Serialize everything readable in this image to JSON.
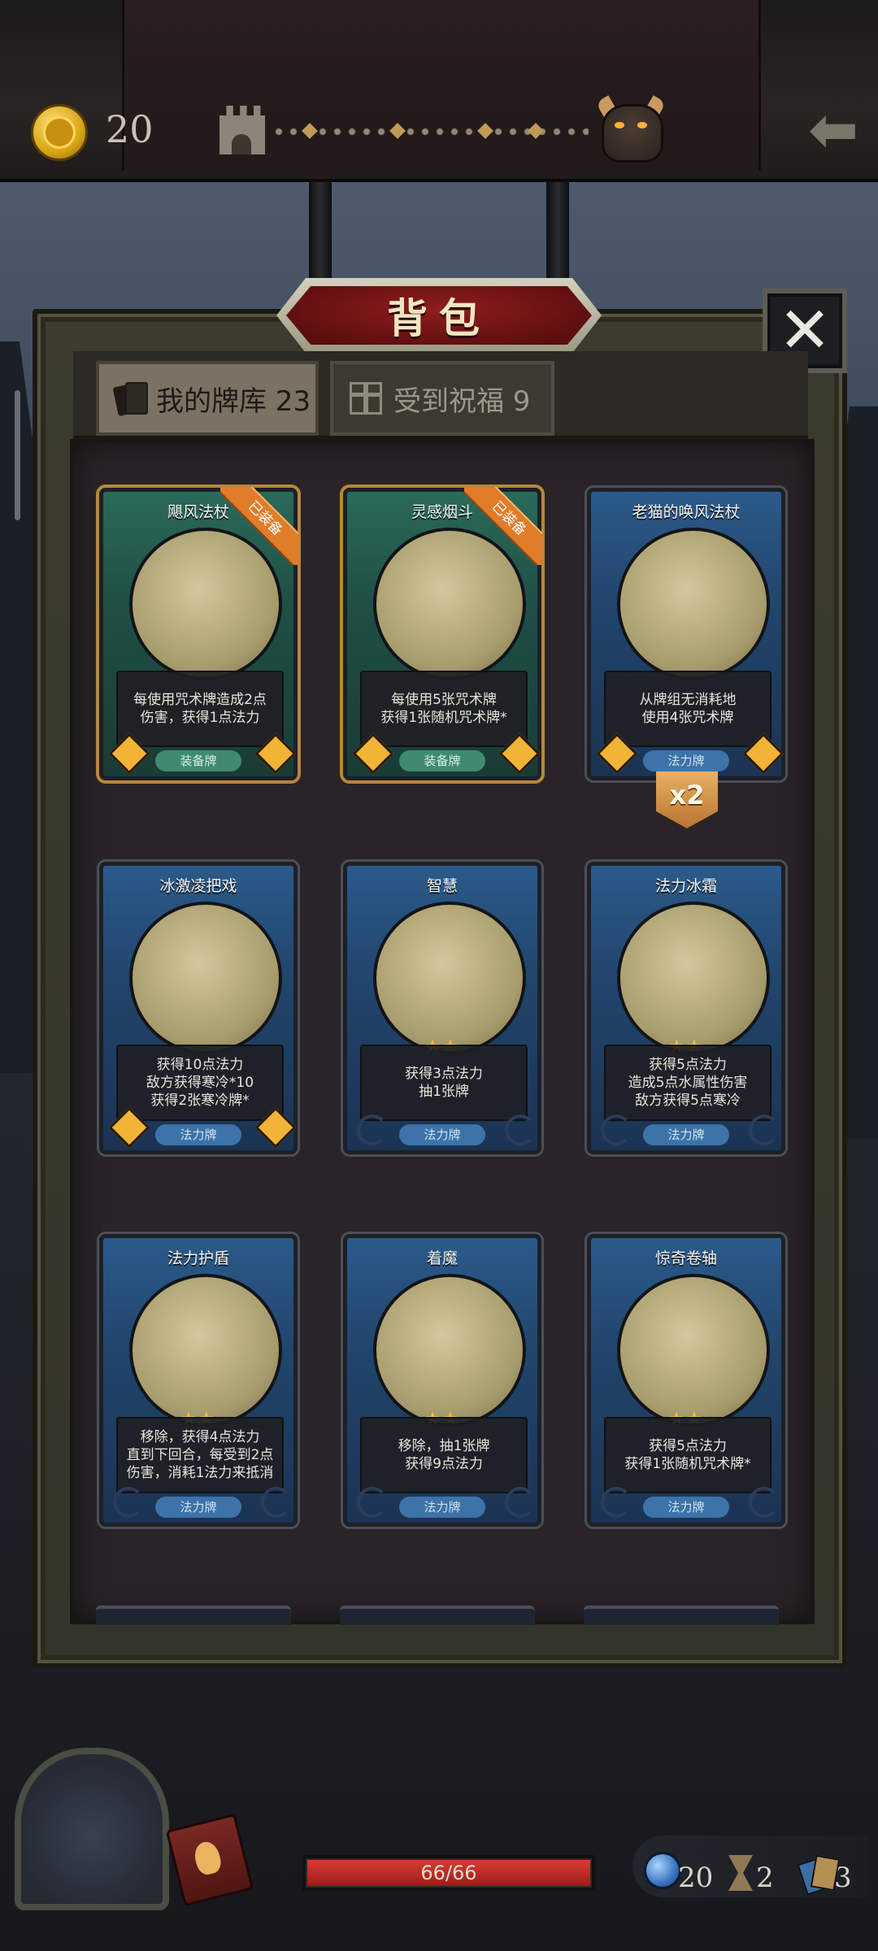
{
  "topbar": {
    "gold": "20",
    "icons": [
      "gold-coin-icon",
      "castle-icon",
      "boss-icon",
      "back-arrow-icon"
    ]
  },
  "panel": {
    "title": "背包",
    "close_label": "✕"
  },
  "tabs": [
    {
      "label": "我的牌库 23",
      "active": true,
      "icon": "cards-icon"
    },
    {
      "label": "受到祝福 9",
      "active": false,
      "icon": "gift-icon"
    }
  ],
  "cards": [
    {
      "name": "飓风法杖",
      "desc": [
        "每使用咒术牌造成2点",
        "伤害，获得1点法力"
      ],
      "type": "装备牌",
      "color": "green",
      "ribbon": "已装备",
      "stars": ""
    },
    {
      "name": "灵感烟斗",
      "desc": [
        "每使用5张咒术牌",
        "获得1张随机咒术牌*"
      ],
      "type": "装备牌",
      "color": "green",
      "ribbon": "已装备",
      "stars": ""
    },
    {
      "name": "老猫的唤风法杖",
      "desc": [
        "从牌组无消耗地",
        "使用4张咒术牌"
      ],
      "type": "法力牌",
      "color": "blue",
      "ribbon": "",
      "stars": "",
      "count": "x2"
    },
    {
      "name": "冰激凌把戏",
      "desc": [
        "获得10点法力",
        "敌方获得寒冷*10",
        "获得2张寒冷牌*"
      ],
      "type": "法力牌",
      "color": "blue",
      "ribbon": "",
      "stars": ""
    },
    {
      "name": "智慧",
      "desc": [
        "获得3点法力",
        "抽1张牌"
      ],
      "type": "法力牌",
      "color": "blue",
      "ribbon": "",
      "stars": "★★"
    },
    {
      "name": "法力冰霜",
      "desc": [
        "获得5点法力",
        "造成5点水属性伤害",
        "敌方获得5点寒冷"
      ],
      "type": "法力牌",
      "color": "blue",
      "ribbon": "",
      "stars": "★★"
    },
    {
      "name": "法力护盾",
      "desc": [
        "移除，获得4点法力",
        "直到下回合，每受到2点",
        "伤害，消耗1法力来抵消"
      ],
      "type": "法力牌",
      "color": "blue",
      "ribbon": "",
      "stars": "★★"
    },
    {
      "name": "着魔",
      "desc": [
        "移除，抽1张牌",
        "获得9点法力"
      ],
      "type": "法力牌",
      "color": "blue",
      "ribbon": "",
      "stars": "★★"
    },
    {
      "name": "惊奇卷轴",
      "desc": [
        "获得5点法力",
        "获得1张随机咒术牌*"
      ],
      "type": "法力牌",
      "color": "blue",
      "ribbon": "",
      "stars": "★★"
    }
  ],
  "bottom": {
    "hp_text": "66/66",
    "hp_fraction": 1.0,
    "stats": [
      {
        "icon": "mana-orb-icon",
        "value": "20"
      },
      {
        "icon": "hourglass-icon",
        "value": "2"
      },
      {
        "icon": "deck-icon",
        "value": "3"
      }
    ]
  },
  "colors": {
    "green_card": "#2b6a5a",
    "blue_card": "#2b5a8a",
    "ribbon": "#e07d2a",
    "title_red": "#8e1d1d",
    "hp_red": "#d73c36"
  }
}
